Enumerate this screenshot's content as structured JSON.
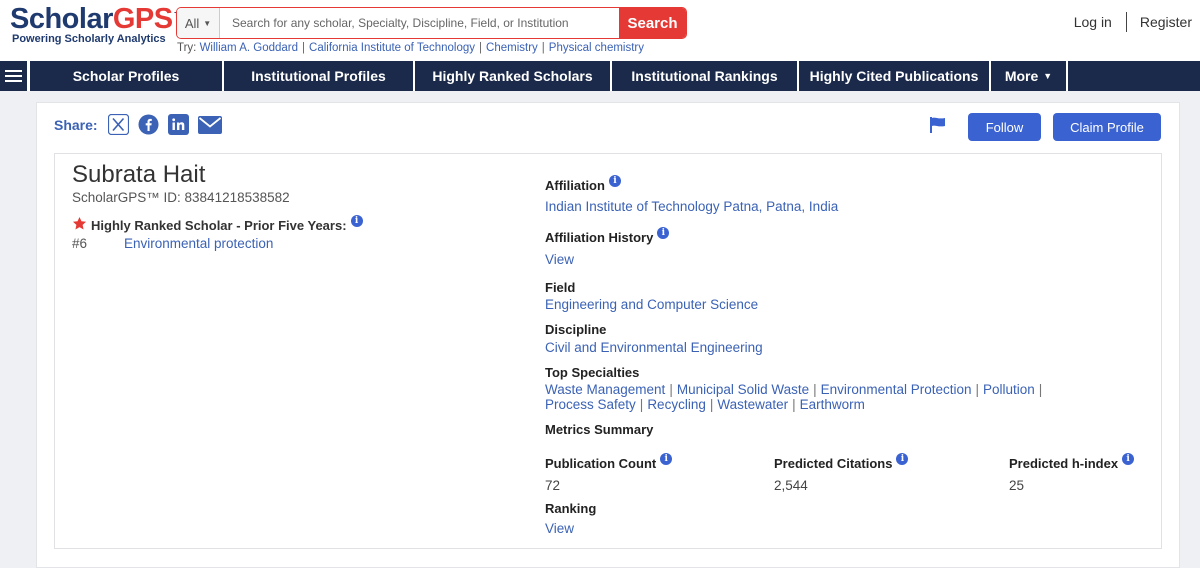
{
  "logo": {
    "main_part1": "Scholar",
    "main_part2": "GPS",
    "tm": "™",
    "tagline": "Powering Scholarly Analytics"
  },
  "search": {
    "scope": "All",
    "placeholder": "Search for any scholar, Specialty, Discipline, Field, or Institution",
    "button": "Search"
  },
  "try": {
    "label": "Try:",
    "items": [
      "William A. Goddard",
      "California Institute of Technology",
      "Chemistry",
      "Physical chemistry"
    ]
  },
  "auth": {
    "login": "Log in",
    "register": "Register"
  },
  "nav": {
    "items": [
      "Scholar Profiles",
      "Institutional Profiles",
      "Highly Ranked Scholars",
      "Institutional Rankings",
      "Highly Cited Publications"
    ],
    "more": "More"
  },
  "share": {
    "label": "Share:"
  },
  "actions": {
    "follow": "Follow",
    "claim": "Claim Profile"
  },
  "profile": {
    "name": "Subrata Hait",
    "scholar_id": "ScholarGPS™ ID: 83841218538582",
    "ranked_label": "Highly Ranked Scholar - Prior Five Years:",
    "rank_number": "#6",
    "rank_area": "Environmental protection"
  },
  "details": {
    "affiliation_label": "Affiliation",
    "affiliation_value": "Indian Institute of Technology Patna, Patna, India",
    "history_label": "Affiliation History",
    "history_value": "View",
    "field_label": "Field",
    "field_value": "Engineering and Computer Science",
    "discipline_label": "Discipline",
    "discipline_value": "Civil and Environmental Engineering",
    "specialties_label": "Top Specialties",
    "specialties_line1": [
      "Waste Management",
      "Municipal Solid Waste",
      "Environmental Protection",
      "Pollution"
    ],
    "specialties_line2": [
      "Process Safety",
      "Recycling",
      "Wastewater",
      "Earthworm"
    ],
    "metrics_label": "Metrics Summary",
    "pub_count_label": "Publication Count",
    "pub_count_value": "72",
    "citations_label": "Predicted Citations",
    "citations_value": "2,544",
    "hindex_label": "Predicted h-index",
    "hindex_value": "25",
    "ranking_label": "Ranking",
    "ranking_value": "View"
  },
  "colors": {
    "brand_navy": "#1b2a4a",
    "brand_red": "#e53935",
    "link_blue": "#3b62b5",
    "button_blue": "#3b62d1"
  }
}
